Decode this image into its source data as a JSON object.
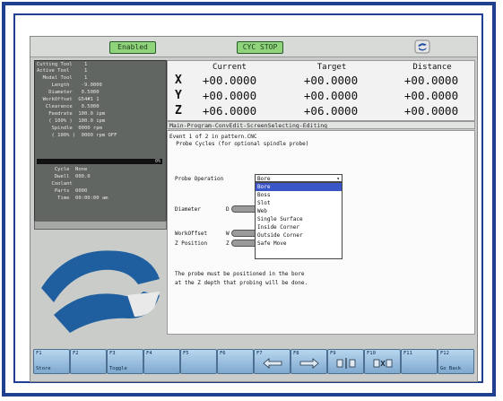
{
  "topbar": {
    "status_label": "Enabled",
    "mode_label": "CYC STOP"
  },
  "status_panel": {
    "rows": [
      "Cutting Tool    1",
      "Active Tool     1",
      "  Modal Tool    1",
      "     Length    -9.0000",
      "    Diameter   0.5000",
      "  WorkOffset  G54#1 1",
      "   Clearance   0.5000",
      "    Feedrate  100.0 ipm",
      "    ( 100% )  100.0 ipm",
      "     Spindle  0000 rpm",
      "     ( 100% )  0000 rpm OFF"
    ],
    "bar_percent": "0%",
    "rows2": [
      "      Cycle  None",
      "      Dwell  000.0",
      "     Coolant",
      "      Parts  0000",
      "       Time  00:00:00 am"
    ]
  },
  "coords": {
    "headers": {
      "current": "Current",
      "target": "Target",
      "distance": "Distance"
    },
    "rows": [
      {
        "axis": "X",
        "current": "+00.0000",
        "target": "+00.0000",
        "distance": "+00.0000"
      },
      {
        "axis": "Y",
        "current": "+00.0000",
        "target": "+00.0000",
        "distance": "+00.0000"
      },
      {
        "axis": "Z",
        "current": "+06.0000",
        "target": "+06.0000",
        "distance": "+00.0000"
      }
    ]
  },
  "breadcrumb": "Main-Program-ConvEdit-ScreenSelecting-Editing",
  "main": {
    "event_line": "Event 1 of 2 in pattern.CNC",
    "cycle_line": "  Probe Cycles (for optional spindle probe)",
    "probe_op_label": "Probe Operation",
    "probe_op_value": "Bore",
    "options": [
      "Bore",
      "Boss",
      "Slot",
      "Web",
      "Single Surface",
      "Inside Corner",
      "Outside Corner",
      "Safe Move"
    ],
    "diameter_label": "Diameter",
    "diameter_prefix": "D",
    "workoffset_label": "WorkOffset",
    "workoffset_prefix": "W",
    "zpos_label": "Z Position",
    "zpos_prefix": "Z",
    "note_line1": "The probe must be positioned in the bore",
    "note_line2": "at the Z depth that probing will be done."
  },
  "fkeys": [
    {
      "fn": "F1",
      "label": "Store"
    },
    {
      "fn": "F2",
      "label": ""
    },
    {
      "fn": "F3",
      "label": "Toggle"
    },
    {
      "fn": "F4",
      "label": ""
    },
    {
      "fn": "F5",
      "label": ""
    },
    {
      "fn": "F6",
      "label": ""
    },
    {
      "fn": "F7",
      "label": "",
      "icon": "arrow-left-icon"
    },
    {
      "fn": "F8",
      "label": "",
      "icon": "arrow-right-icon"
    },
    {
      "fn": "F9",
      "label": "",
      "icon": "insert-icon"
    },
    {
      "fn": "F10",
      "label": "",
      "icon": "delete-icon"
    },
    {
      "fn": "F11",
      "label": ""
    },
    {
      "fn": "F12",
      "label": "Go Back"
    }
  ],
  "colors": {
    "frame": "#1f3f8f",
    "pill": "#8fd37a",
    "selected": "#3a55c7",
    "fkey": "#7fa9cf"
  }
}
